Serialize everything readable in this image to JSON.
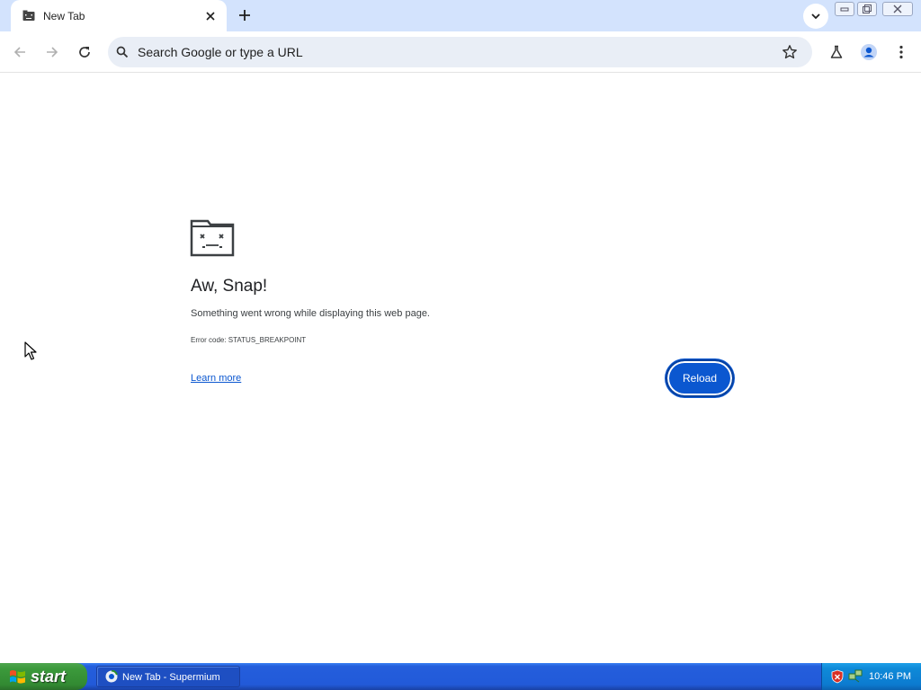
{
  "browser": {
    "tab": {
      "title": "New Tab",
      "favicon": "sad-tab-icon"
    },
    "omnibox": {
      "placeholder": "Search Google or type a URL"
    },
    "icons": {
      "back": "arrow-left-icon",
      "forward": "arrow-right-icon",
      "reload": "reload-icon",
      "search": "search-icon",
      "bookmark": "star-icon",
      "labs": "flask-icon",
      "profile": "profile-icon",
      "menu": "kebab-menu-icon"
    }
  },
  "error_page": {
    "title": "Aw, Snap!",
    "message": "Something went wrong while displaying this web page.",
    "error_code": "Error code: STATUS_BREAKPOINT",
    "learn_more": "Learn more",
    "reload_label": "Reload"
  },
  "taskbar": {
    "start_label": "start",
    "task_label": "New Tab - Supermium",
    "clock": "10:46 PM"
  },
  "colors": {
    "tabstrip": "#d3e3fd",
    "omnibox": "#e9eef6",
    "accent": "#0b57d0",
    "taskbar": "#245edc",
    "start": "#3c9a3c",
    "tray": "#0f8ad8"
  }
}
